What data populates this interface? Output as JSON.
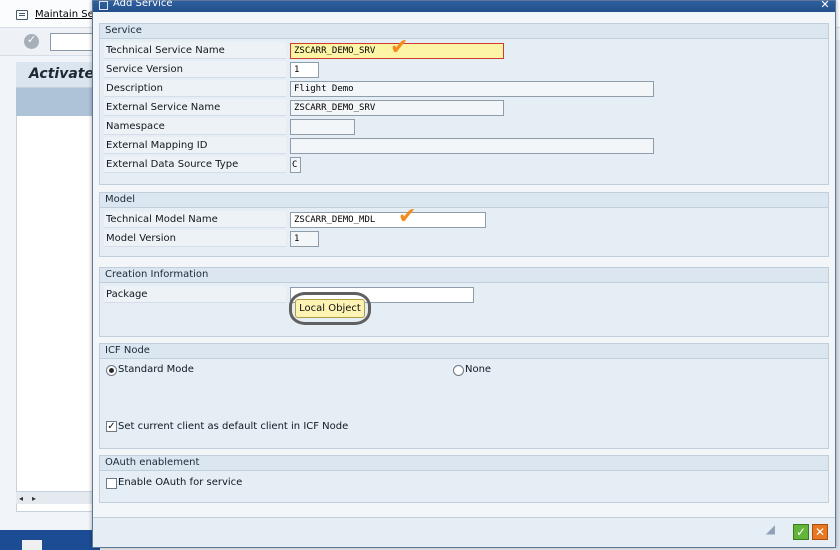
{
  "background": {
    "menu_label": "Maintain Se",
    "panel_title": "Activate",
    "scroll_left": "◂",
    "scroll_right": "▸"
  },
  "dialog": {
    "title": "Add Service",
    "close_glyph": "✕"
  },
  "service": {
    "header": "Service",
    "rows": [
      {
        "label": "Technical Service Name",
        "value": "ZSCARR_DEMO_SRV"
      },
      {
        "label": "Service Version",
        "value": "1"
      },
      {
        "label": "Description",
        "value": "Flight Demo"
      },
      {
        "label": "External Service Name",
        "value": "ZSCARR_DEMO_SRV"
      },
      {
        "label": "Namespace",
        "value": ""
      },
      {
        "label": "External Mapping ID",
        "value": ""
      },
      {
        "label": "External Data Source Type",
        "value": "C"
      }
    ]
  },
  "model": {
    "header": "Model",
    "rows": [
      {
        "label": "Technical Model Name",
        "value": "ZSCARR_DEMO_MDL"
      },
      {
        "label": "Model Version",
        "value": "1"
      }
    ]
  },
  "creation": {
    "header": "Creation Information",
    "package_label": "Package",
    "package_value": "",
    "local_object_label": "Local Object"
  },
  "icf": {
    "header": "ICF Node",
    "standard_mode": "Standard Mode",
    "none": "None",
    "selected": "Standard Mode",
    "default_client_label": "Set current client as default client in ICF Node",
    "default_client_checked": true
  },
  "oauth": {
    "header": "OAuth enablement",
    "enable_label": "Enable OAuth for service",
    "enable_checked": false
  },
  "footer": {
    "ok_glyph": "✓",
    "cancel_glyph": "✕"
  },
  "annotations": {
    "check_glyph": "✔",
    "check_color": "#f28c1c"
  }
}
